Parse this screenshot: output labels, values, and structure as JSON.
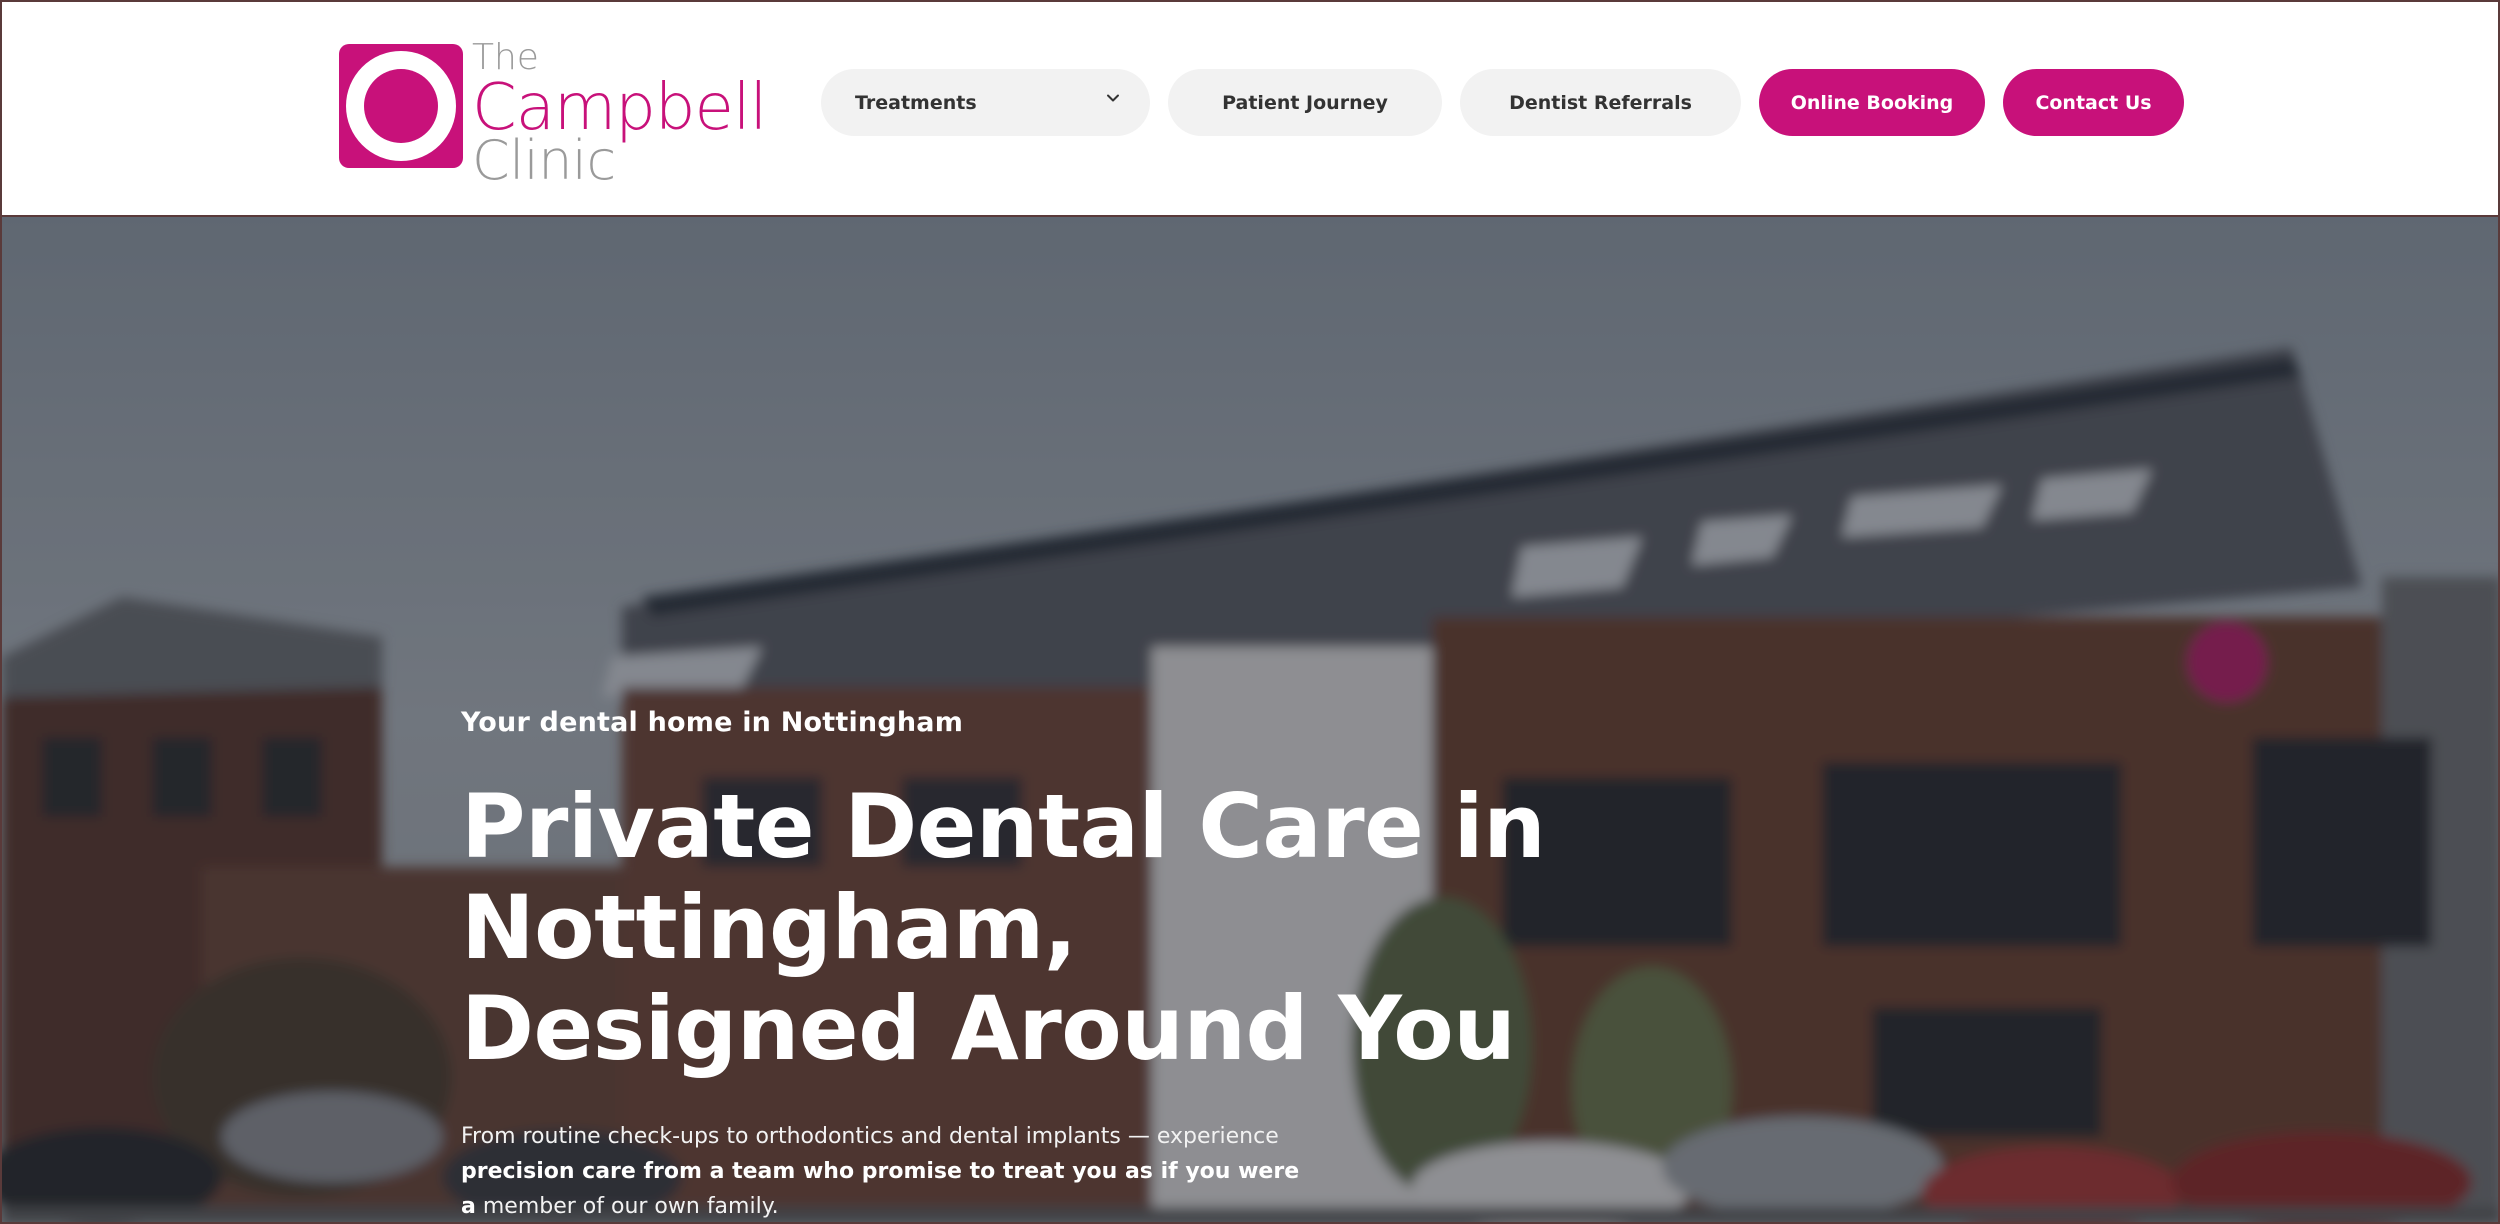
{
  "brand": {
    "line1": "The",
    "line2": "Campbell",
    "line3": "Clinic",
    "accent_color": "#c8117a",
    "grey_color": "#9a9a9a"
  },
  "nav": {
    "treatments": "Treatments",
    "patient_journey": "Patient Journey",
    "dentist_referrals": "Dentist Referrals",
    "online_booking": "Online Booking",
    "contact_us": "Contact Us"
  },
  "hero": {
    "eyebrow": "Your dental home in Nottingham",
    "headline": "Private Dental Care in Nottingham, Designed Around You",
    "lede_plain": "From routine check-ups to orthodontics and dental implants — experience ",
    "lede_bold": "precision care from a team who promise to treat you as if you were a",
    "lede_end": " member of our own family."
  },
  "icons": {
    "dropdown": "chevron-down-icon",
    "logo": "campbell-clinic-logo"
  }
}
